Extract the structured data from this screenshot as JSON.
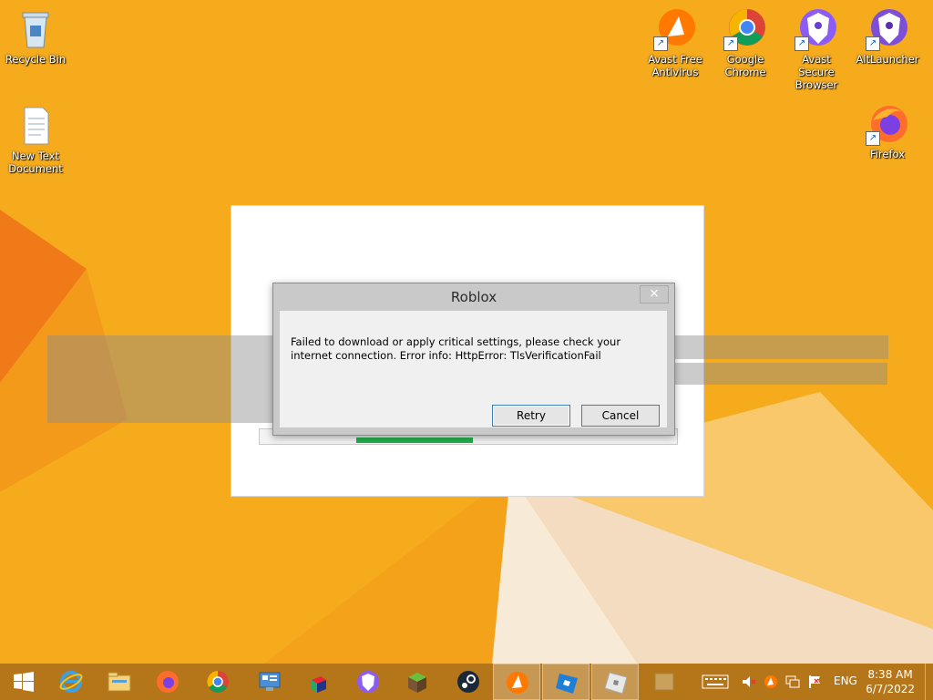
{
  "desktop": {
    "icons": {
      "recycle_bin": "Recycle Bin",
      "new_text_document": "New Text Document",
      "avast_free_antivirus": "Avast Free Antivirus",
      "google_chrome": "Google Chrome",
      "avast_secure_browser": "Avast Secure Browser",
      "altlauncher": "AltLauncher",
      "firefox": "Firefox"
    }
  },
  "splash": {
    "progress": 0.28
  },
  "dialog": {
    "title": "Roblox",
    "close_label": "×",
    "message": "Failed to download or apply critical settings, please check your internet connection. Error info: HttpError: TlsVerificationFail",
    "retry_label": "Retry",
    "cancel_label": "Cancel"
  },
  "taskbar": {
    "apps": [
      "start-icon",
      "internet-explorer-icon",
      "file-explorer-icon",
      "firefox-icon",
      "chrome-icon",
      "control-panel-icon",
      "app-launcher-icon",
      "avast-secure-browser-icon",
      "minecraft-icon",
      "steam-icon",
      "avast-icon",
      "roblox-studio-icon",
      "roblox-icon",
      "window-icon"
    ],
    "language": "ENG",
    "time": "8:38 AM",
    "date": "6/7/2022"
  },
  "colors": {
    "wallpaper": "#f5a81c",
    "taskbar": "#b5761a",
    "progress": "#22b04a"
  }
}
